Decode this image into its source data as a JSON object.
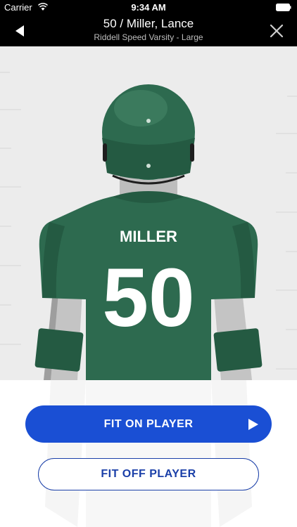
{
  "status_bar": {
    "carrier": "Carrier",
    "time": "9:34 AM"
  },
  "header": {
    "title": "50 / Miller, Lance",
    "subtitle": "Riddell Speed Varsity - Large"
  },
  "player": {
    "jersey_name": "MILLER",
    "jersey_number": "50"
  },
  "actions": {
    "fit_on_label": "FIT ON PLAYER",
    "fit_off_label": "FIT OFF PLAYER"
  },
  "colors": {
    "jersey_green": "#2d6a4f",
    "button_blue": "#1a4fd4",
    "outline_blue": "#1a3fa8"
  },
  "icons": {
    "back": "back-arrow-icon",
    "close": "close-icon",
    "play": "play-icon"
  }
}
